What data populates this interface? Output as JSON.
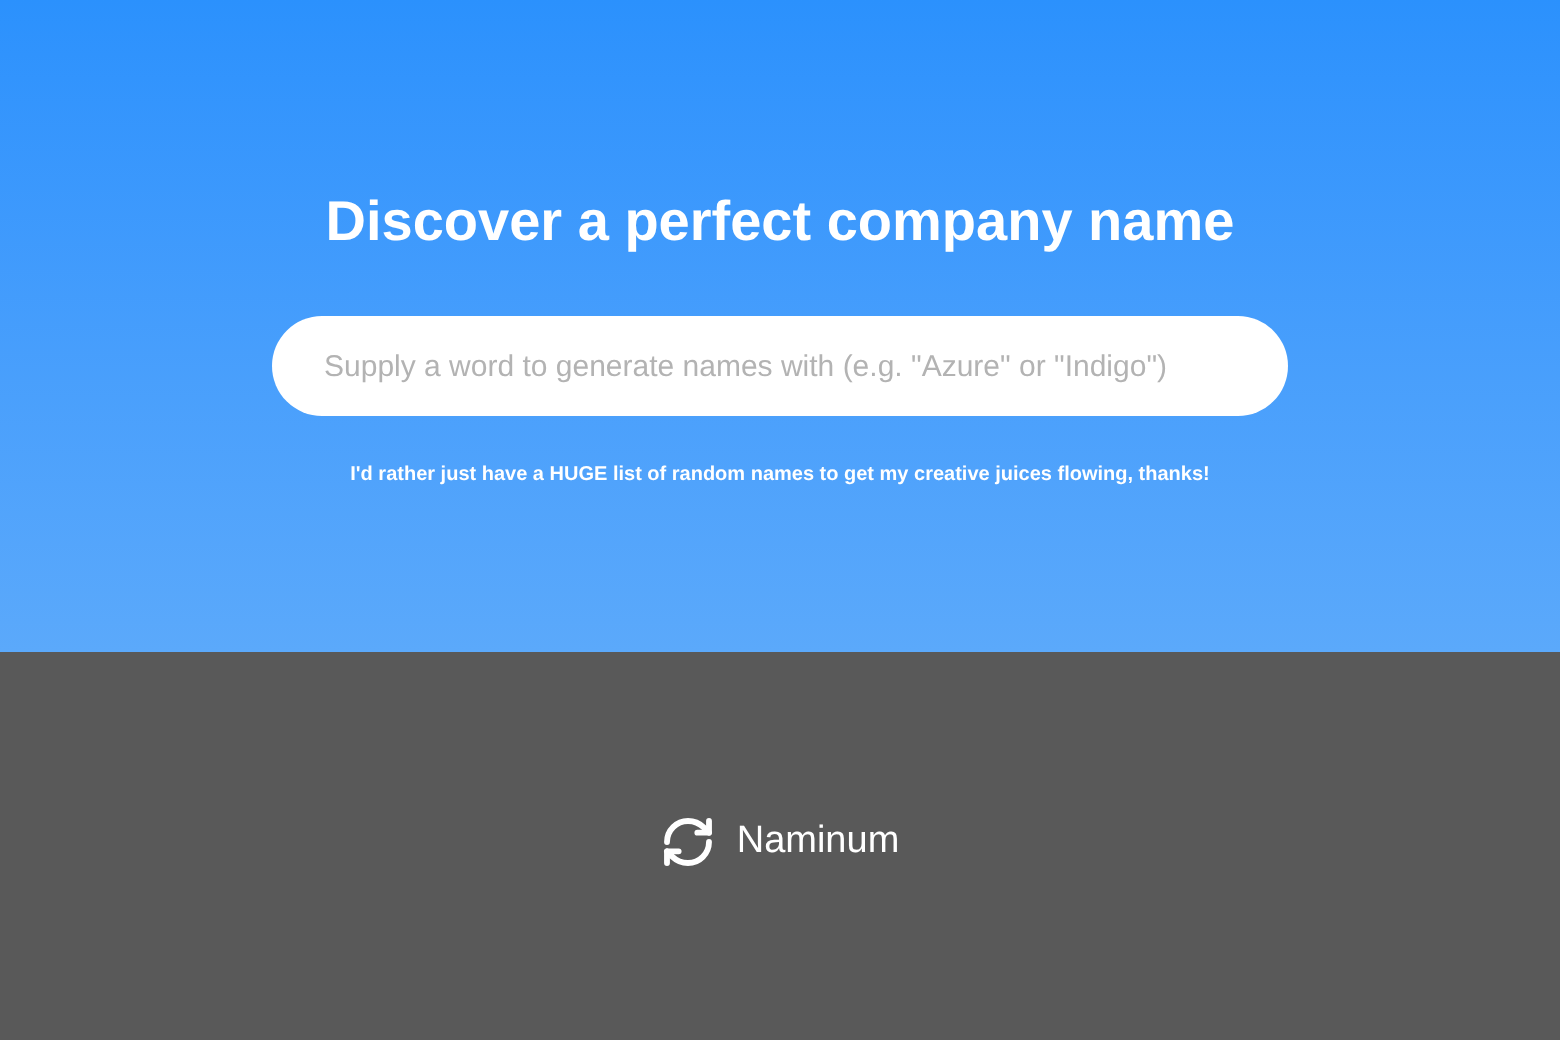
{
  "hero": {
    "title": "Discover a perfect company name",
    "search": {
      "placeholder": "Supply a word to generate names with (e.g. \"Azure\" or \"Indigo\")"
    },
    "random_link": "I'd rather just have a HUGE list of random names to get my creative juices flowing, thanks!"
  },
  "footer": {
    "brand": "Naminum"
  }
}
